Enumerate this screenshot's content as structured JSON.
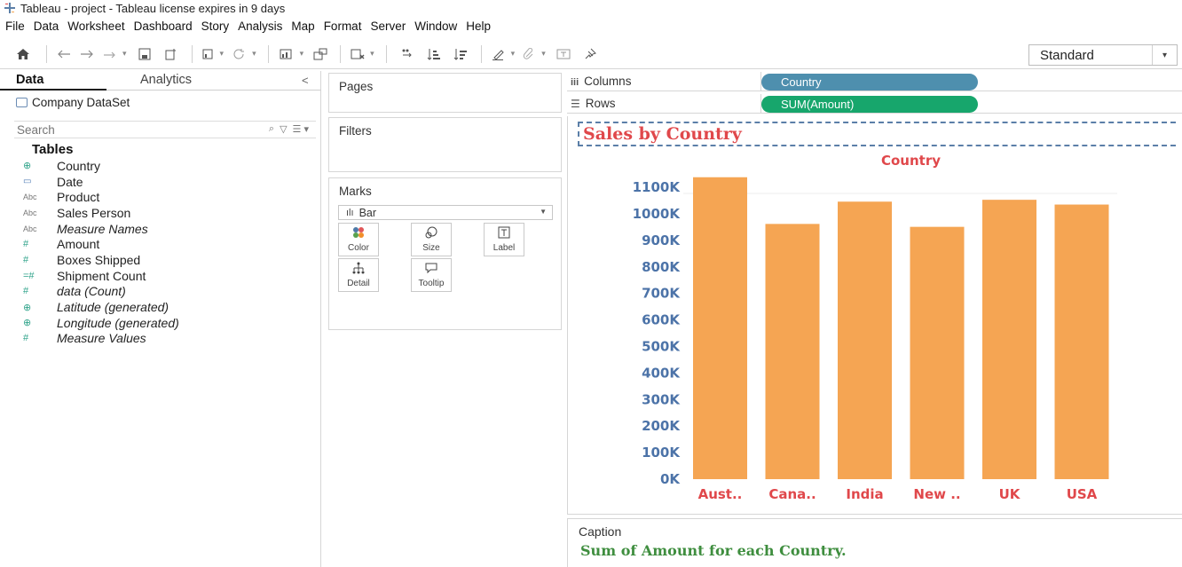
{
  "window": {
    "title": "Tableau - project - Tableau license expires in 9 days"
  },
  "menu": [
    "File",
    "Data",
    "Worksheet",
    "Dashboard",
    "Story",
    "Analysis",
    "Map",
    "Format",
    "Server",
    "Window",
    "Help"
  ],
  "toolbar": {
    "view_size": "Standard"
  },
  "data_pane": {
    "tab_data": "Data",
    "tab_analytics": "Analytics",
    "datasource": "Company DataSet",
    "search_placeholder": "Search",
    "tables_heading": "Tables",
    "fields": [
      {
        "name": "Country",
        "type_icon": "geo-globe-icon",
        "badge": "⊕",
        "italic": false
      },
      {
        "name": "Date",
        "type_icon": "date-calendar-icon",
        "badge": "▭",
        "italic": false
      },
      {
        "name": "Product",
        "type_icon": "string-abc-icon",
        "badge": "Abc",
        "italic": false
      },
      {
        "name": "Sales Person",
        "type_icon": "string-abc-icon",
        "badge": "Abc",
        "italic": false
      },
      {
        "name": "Measure Names",
        "type_icon": "string-abc-icon",
        "badge": "Abc",
        "italic": true
      },
      {
        "name": "Amount",
        "type_icon": "number-measure-icon",
        "badge": "#",
        "italic": false
      },
      {
        "name": "Boxes Shipped",
        "type_icon": "number-measure-icon",
        "badge": "#",
        "italic": false
      },
      {
        "name": "Shipment Count",
        "type_icon": "calculated-number-icon",
        "badge": "=#",
        "italic": false
      },
      {
        "name": "data (Count)",
        "type_icon": "number-measure-icon",
        "badge": "#",
        "italic": true
      },
      {
        "name": "Latitude (generated)",
        "type_icon": "geo-globe-icon",
        "badge": "⊕",
        "italic": true
      },
      {
        "name": "Longitude (generated)",
        "type_icon": "geo-globe-icon",
        "badge": "⊕",
        "italic": true
      },
      {
        "name": "Measure Values",
        "type_icon": "number-measure-icon",
        "badge": "#",
        "italic": true
      }
    ]
  },
  "cards": {
    "pages": "Pages",
    "filters": "Filters",
    "marks": "Marks",
    "mark_type": "Bar",
    "mark_buttons": {
      "color": "Color",
      "size": "Size",
      "label": "Label",
      "detail": "Detail",
      "tooltip": "Tooltip"
    }
  },
  "shelves": {
    "columns_label": "Columns",
    "rows_label": "Rows",
    "columns_pill": "Country",
    "rows_pill": "SUM(Amount)"
  },
  "sheet": {
    "title": "Sales by Country",
    "caption_label": "Caption",
    "caption_text": "Sum of Amount for each Country."
  },
  "colors": {
    "bar": "#f5a553",
    "title_red": "#e0484b",
    "axis_blue": "#4c73a8",
    "columns_pill": "#4e8fae",
    "rows_pill": "#17a66c",
    "caption_green": "#3f8e3f"
  },
  "chart_data": {
    "type": "bar",
    "title": "Country",
    "categories": [
      "Aust..",
      "Cana..",
      "India",
      "New ..",
      "UK",
      "USA"
    ],
    "values": [
      1138000,
      962000,
      1046000,
      951000,
      1053000,
      1035000
    ],
    "ylim": [
      0,
      1150000
    ],
    "yticks": [
      0,
      100000,
      200000,
      300000,
      400000,
      500000,
      600000,
      700000,
      800000,
      900000,
      1000000,
      1100000
    ],
    "ytick_labels": [
      "0K",
      "100K",
      "200K",
      "300K",
      "400K",
      "500K",
      "600K",
      "700K",
      "800K",
      "900K",
      "1000K",
      "1100K"
    ],
    "xlabel": "",
    "ylabel": "",
    "grid": false
  }
}
